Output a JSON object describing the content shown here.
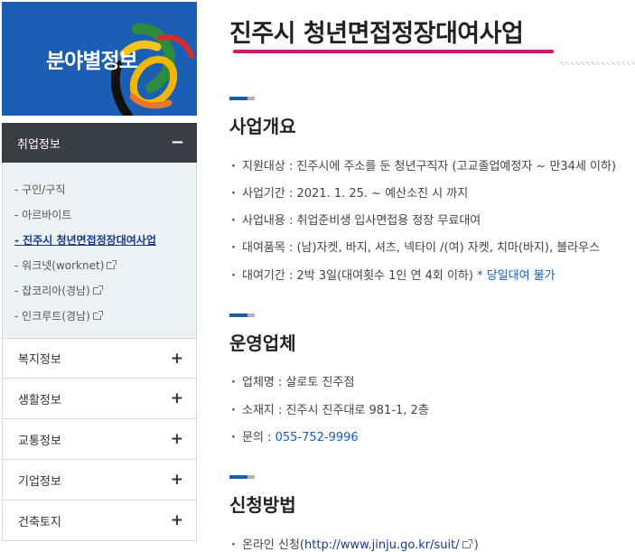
{
  "sidebar": {
    "banner_title": "분야별정보",
    "active_section": "취업정보",
    "subitems": [
      {
        "label": "구인/구직",
        "external": false,
        "active": false
      },
      {
        "label": "아르바이트",
        "external": false,
        "active": false
      },
      {
        "label": "진주시 청년면접정장대여사업",
        "external": false,
        "active": true
      },
      {
        "label": "워크넷(worknet)",
        "external": true,
        "active": false
      },
      {
        "label": "잡코리아(경남)",
        "external": true,
        "active": false
      },
      {
        "label": "인크루트(경남)",
        "external": true,
        "active": false
      }
    ],
    "sections": [
      "복지정보",
      "생활정보",
      "교통정보",
      "기업정보",
      "건축토지"
    ],
    "collapse_icon": "minus-icon",
    "expand_icon": "plus-icon"
  },
  "main": {
    "title": "진주시 청년면접정장대여사업",
    "sections": [
      {
        "title": "사업개요",
        "items": [
          {
            "text": "지원대상 : 진주시에 주소를 둔 청년구직자 (고교졸업예정자 ~ 만34세 이하)"
          },
          {
            "text": "사업기간 : 2021. 1. 25. ~ 예산소진 시 까지"
          },
          {
            "text": "사업내용 : 취업준비생 입사면접용 정장 무료대여"
          },
          {
            "text": "대여품목 : (남)자켓, 바지, 셔츠, 넥타이 /(여) 자켓, 치마(바지), 블라우스"
          },
          {
            "text": "대여기간 : 2박 3일(대여횟수 1인 연 4회 이하) ",
            "highlight": "* 당일대여 불가"
          }
        ]
      },
      {
        "title": "운영업체",
        "items": [
          {
            "text": "업체명 : 살로토 진주점"
          },
          {
            "text": "소재지 : 진주시 진주대로 981-1, 2층"
          },
          {
            "text": "문의 : ",
            "highlight": "055-752-9996"
          }
        ]
      },
      {
        "title": "신청방법",
        "items": [
          {
            "text": "온라인 신청(",
            "link": "http://www.jinju.go.kr/suit/",
            "after": " )"
          }
        ]
      }
    ]
  },
  "colors": {
    "banner_bg": "#1a5fb4",
    "menu_head_bg": "#3a3d44",
    "submenu_bg": "#ecf1f3",
    "title_underline": "#d4156e",
    "accent_blue": "#1a5fb4",
    "active_link": "#1b3a8c"
  }
}
